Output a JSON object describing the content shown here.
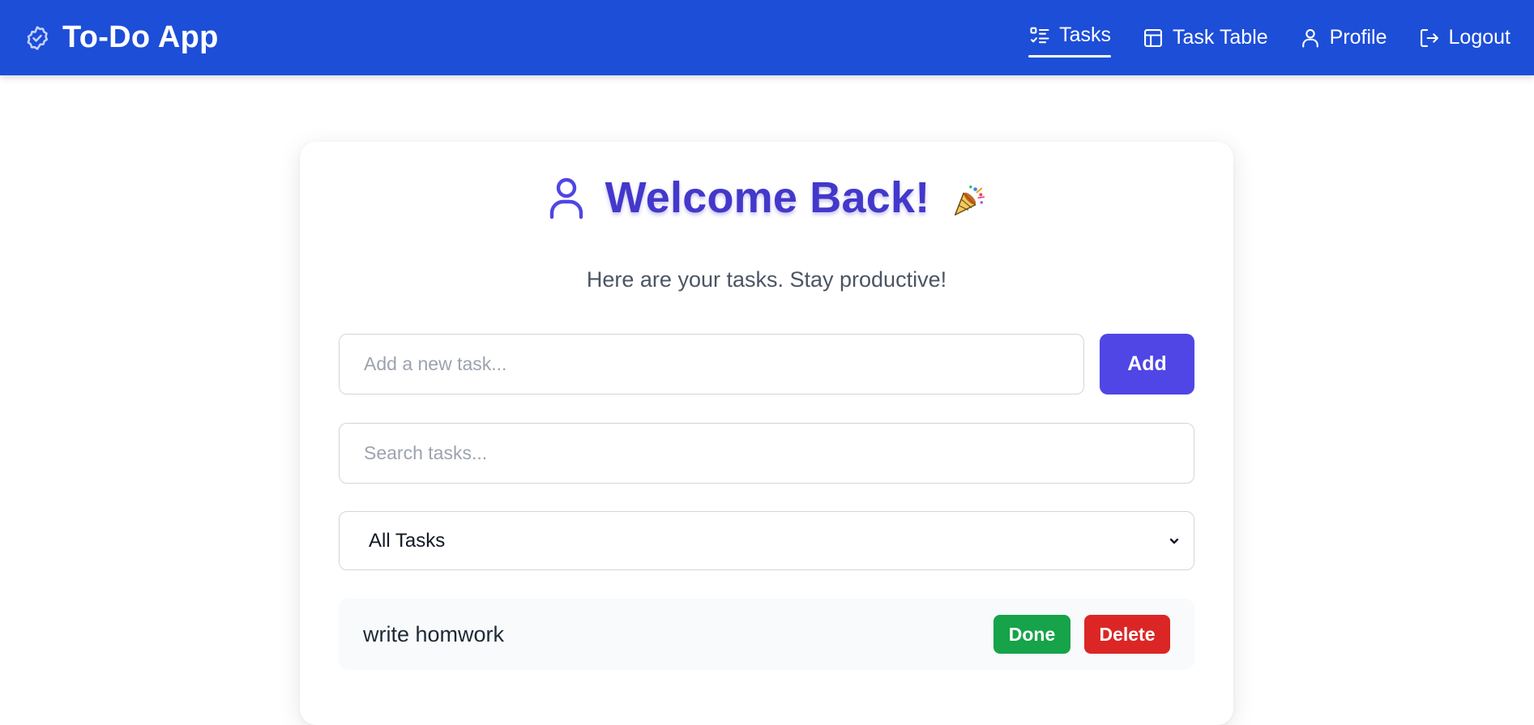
{
  "app": {
    "title": "To-Do App",
    "brand_icon": "badge-check-icon"
  },
  "nav": {
    "items": [
      {
        "label": "Tasks",
        "icon": "list-checks-icon",
        "active": true
      },
      {
        "label": "Task Table",
        "icon": "table-icon",
        "active": false
      },
      {
        "label": "Profile",
        "icon": "user-icon",
        "active": false
      },
      {
        "label": "Logout",
        "icon": "logout-icon",
        "active": false
      }
    ]
  },
  "main": {
    "welcome_title": "Welcome Back!",
    "welcome_icon": "user-icon",
    "party_icon": "party-popper-icon",
    "subtitle": "Here are your tasks. Stay productive!",
    "new_task": {
      "placeholder": "Add a new task...",
      "value": ""
    },
    "add_label": "Add",
    "search": {
      "placeholder": "Search tasks...",
      "value": ""
    },
    "filter": {
      "selected": "All Tasks"
    },
    "tasks": [
      {
        "text": "write homwork",
        "done_label": "Done",
        "delete_label": "Delete"
      }
    ]
  },
  "colors": {
    "navbar": "#1d4ed8",
    "accent": "#4f46e5",
    "heading": "#4338ca",
    "done": "#16a34a",
    "delete": "#dc2626"
  }
}
